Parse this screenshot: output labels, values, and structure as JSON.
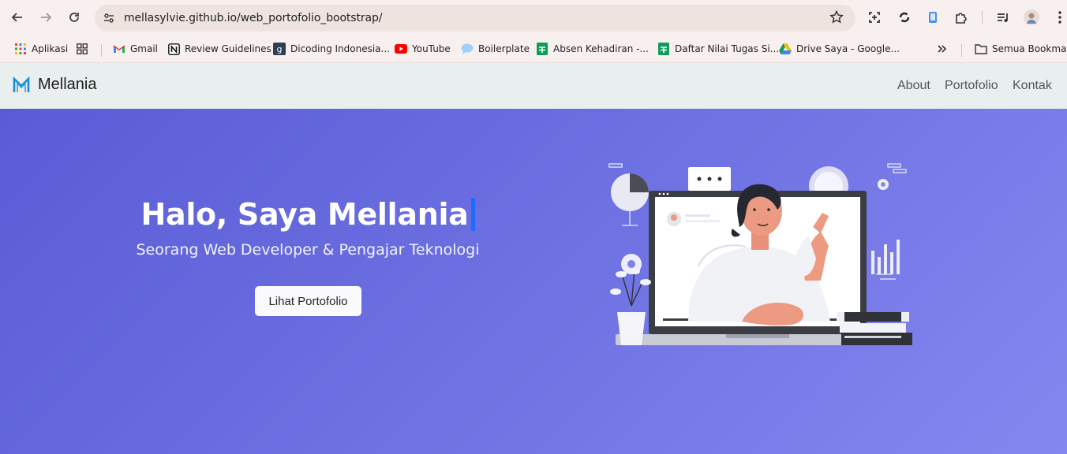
{
  "browser": {
    "url": "mellasylvie.github.io/web_portofolio_bootstrap/"
  },
  "bookmarks": {
    "items": [
      {
        "label": "Aplikasi",
        "icon": "apps-grid-icon"
      },
      {
        "label": "",
        "icon": "tab-groups-icon"
      },
      {
        "label": "Gmail",
        "icon": "gmail-icon"
      },
      {
        "label": "Review Guidelines",
        "icon": "notion-icon"
      },
      {
        "label": "Dicoding Indonesia...",
        "icon": "dicoding-icon"
      },
      {
        "label": "YouTube",
        "icon": "youtube-icon"
      },
      {
        "label": "Boilerplate",
        "icon": "chat-bubble-icon"
      },
      {
        "label": "Absen Kehadiran -...",
        "icon": "sheets-icon"
      },
      {
        "label": "Daftar Nilai Tugas Si...",
        "icon": "sheets-icon"
      },
      {
        "label": "Drive Saya - Google...",
        "icon": "google-drive-icon"
      }
    ],
    "all_bookmarks_label": "Semua Bookmark"
  },
  "site": {
    "brand": "Mellania",
    "nav": [
      "About",
      "Portofolio",
      "Kontak"
    ]
  },
  "hero": {
    "title": "Halo, Saya Mellania",
    "subtitle": "Seorang Web Developer & Pengajar Teknologi",
    "button": "Lihat Portofolio"
  },
  "colors": {
    "hero_gradient_start": "#5a5cd6",
    "hero_gradient_end": "#8587f0",
    "navbar_bg": "#e9eeee",
    "cursor": "#1e6bff"
  }
}
